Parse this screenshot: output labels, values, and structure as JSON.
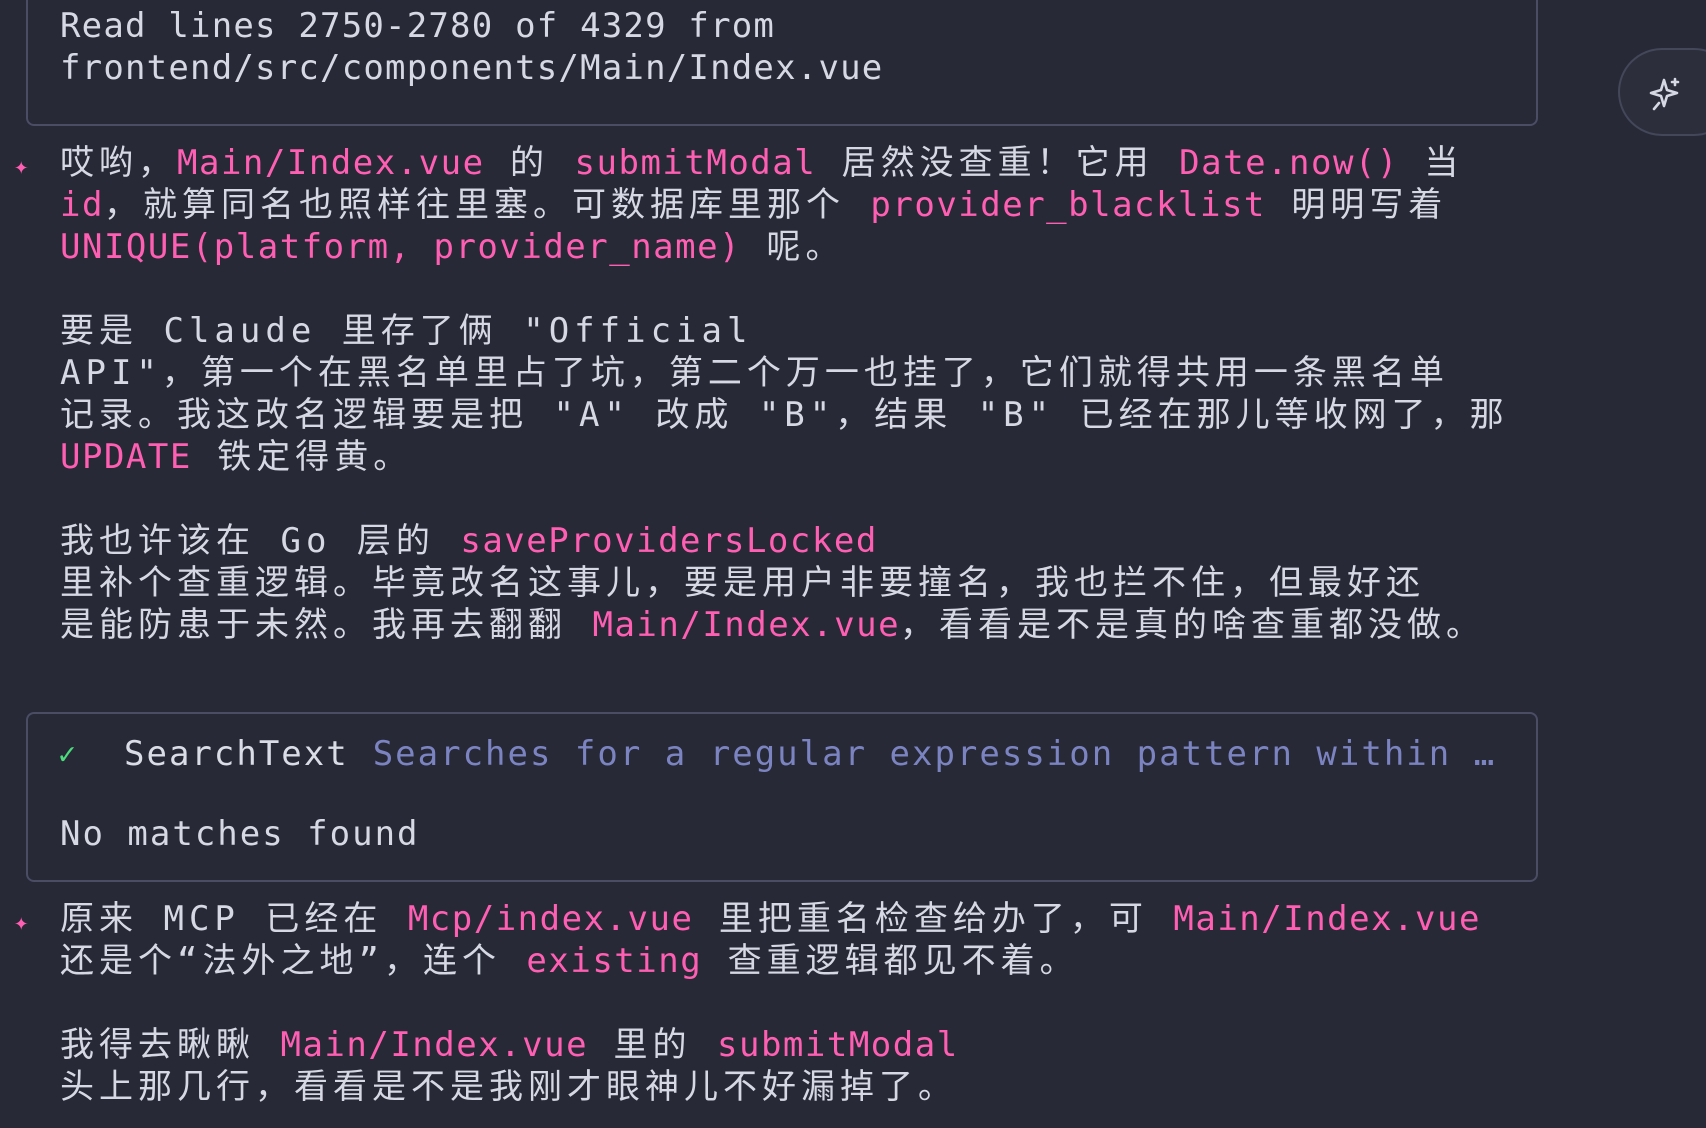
{
  "read_tool": {
    "line1": "Read lines 2750-2780 of 4329 from",
    "line2": "frontend/src/components/Main/Index.vue"
  },
  "message1": {
    "p1": {
      "l1": {
        "t1": "哎哟，",
        "c1": "Main/Index.vue",
        "t2": " 的 ",
        "c2": "submitModal",
        "t3": " 居然没查重！它用 ",
        "c3": "Date.now()",
        "t4": " 当"
      },
      "l2": {
        "c1": "id",
        "t1": "，就算同名也照样往里塞。可数据库里那个 ",
        "c2": "provider_blacklist",
        "t2": " 明明写着"
      },
      "l3": {
        "c1": "UNIQUE(platform, provider_name)",
        "t1": " 呢。"
      }
    },
    "p2": {
      "l1": "要是 Claude 里存了俩 \"Official",
      "l2": "API\"，第一个在黑名单里占了坑，第二个万一也挂了，它们就得共用一条黑名单",
      "l3": "记录。我这改名逻辑要是把 \"A\" 改成 \"B\"，结果 \"B\" 已经在那儿等收网了，那",
      "l4": {
        "c1": "UPDATE",
        "t1": " 铁定得黄。"
      }
    },
    "p3": {
      "l1": {
        "t1": "我也许该在 Go 层的 ",
        "c1": "saveProvidersLocked"
      },
      "l2": "里补个查重逻辑。毕竟改名这事儿，要是用户非要撞名，我也拦不住，但最好还",
      "l3": {
        "t1": "是能防患于未然。我再去翻翻 ",
        "c1": "Main/Index.vue",
        "t2": "，看看是不是真的啥查重都没做。"
      }
    }
  },
  "search_tool": {
    "name": "SearchText",
    "description": "Searches for a regular expression pattern within f…",
    "result": "No matches found",
    "status_icon": "check-icon"
  },
  "message2": {
    "p1": {
      "l1": {
        "t1": "原来 MCP 已经在 ",
        "c1": "Mcp/index.vue",
        "t2": " 里把重名检查给办了，可 ",
        "c2": "Main/Index.vue"
      },
      "l2": {
        "t1": "还是个“法外之地”，连个 ",
        "c1": "existing",
        "t2": " 查重逻辑都见不着。"
      }
    },
    "p2": {
      "l1": {
        "t1": "我得去瞅瞅 ",
        "c1": "Main/Index.vue",
        "t2": " 里的 ",
        "c2": "submitModal"
      },
      "l2": "头上那几行，看看是不是我刚才眼神儿不好漏掉了。"
    }
  },
  "icons": {
    "thinking_marker": "sparkle-icon",
    "side_button": "sparkle-pen-icon"
  },
  "colors": {
    "background": "#272937",
    "code": "#ff5fb2",
    "text": "#d6d8e3",
    "tool_description": "#7b84c0",
    "success": "#4bdc7b",
    "border": "#4a4d63"
  }
}
